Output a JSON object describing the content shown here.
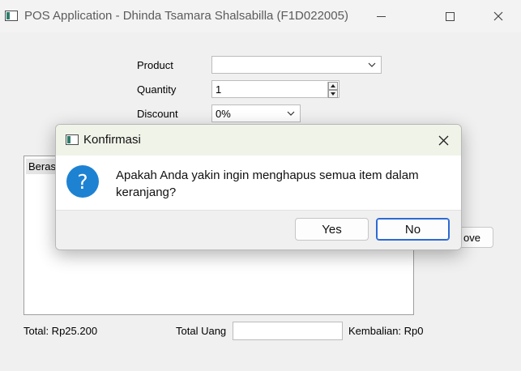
{
  "window": {
    "title": "POS Application - Dhinda Tsamara Shalsabilla (F1D022005)"
  },
  "form": {
    "product_label": "Product",
    "product_value": "",
    "quantity_label": "Quantity",
    "quantity_value": "1",
    "discount_label": "Discount",
    "discount_value": "0%"
  },
  "cart": {
    "items": [
      "Beras"
    ],
    "remove_label": "ove"
  },
  "footer": {
    "total": "Total: Rp25.200",
    "total_uang_label": "Total Uang",
    "total_uang_value": "",
    "kembalian": "Kembalian: Rp0"
  },
  "dialog": {
    "title": "Konfirmasi",
    "message": "Apakah Anda yakin ingin menghapus semua item dalam keranjang?",
    "yes_label": "Yes",
    "no_label": "No",
    "icon": "question-icon"
  },
  "colors": {
    "question_icon": "#1e82d2",
    "default_button_border": "#2d6ad4",
    "dialog_titlebar": "#f0f3e8"
  }
}
